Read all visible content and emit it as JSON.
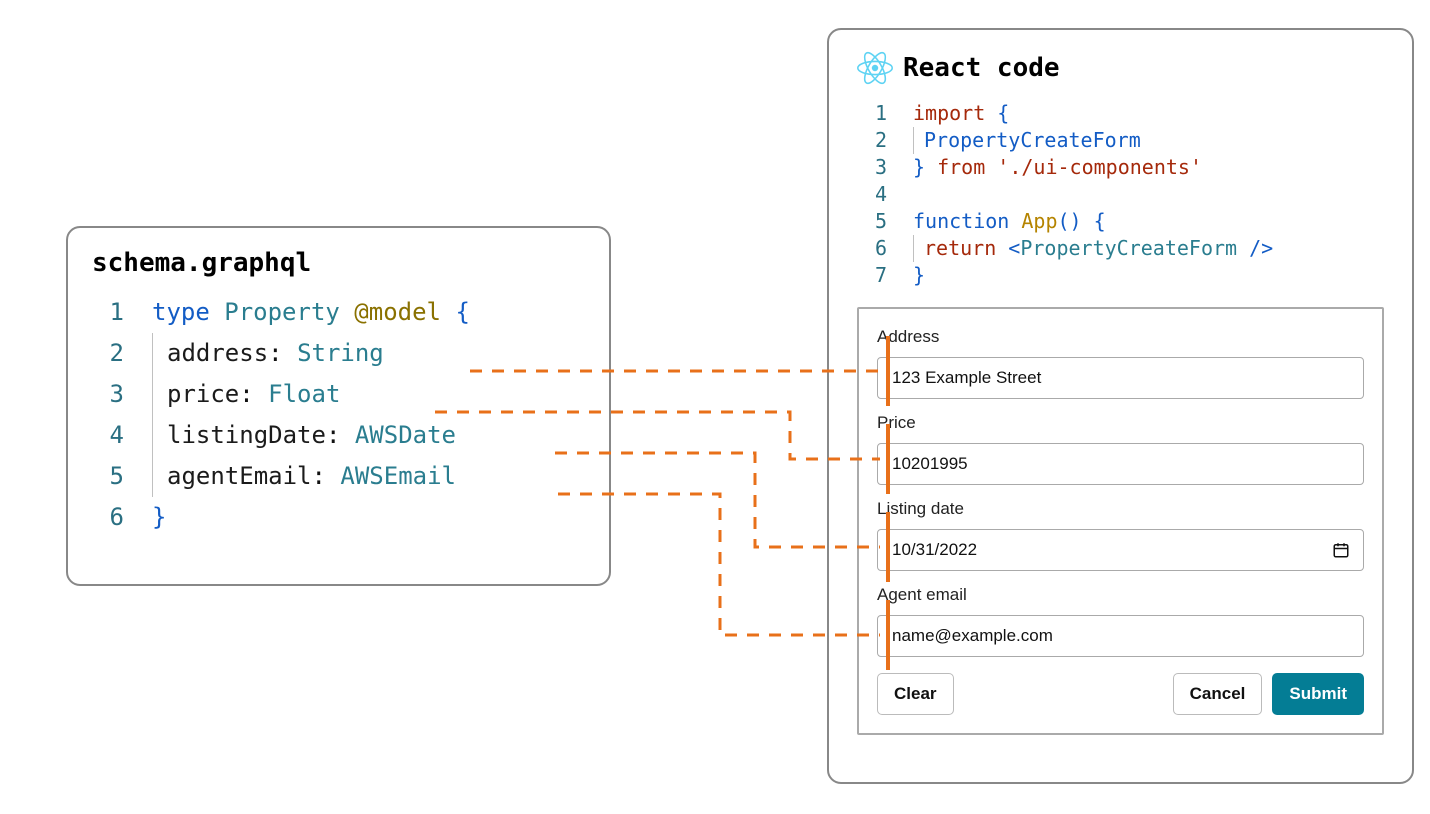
{
  "left": {
    "title": "schema.graphql",
    "lines": [
      {
        "ln": "1",
        "raw": "type Property @model {"
      },
      {
        "ln": "2",
        "field": "address",
        "type": "String"
      },
      {
        "ln": "3",
        "field": "price",
        "type": "Float"
      },
      {
        "ln": "4",
        "field": "listingDate",
        "type": "AWSDate"
      },
      {
        "ln": "5",
        "field": "agentEmail",
        "type": "AWSEmail"
      },
      {
        "ln": "6",
        "raw": "}"
      }
    ]
  },
  "right": {
    "title": "React code",
    "code_lines": {
      "l1": "1",
      "l2": "2",
      "l3": "3",
      "l4": "4",
      "l5": "5",
      "l6": "6",
      "l7": "7",
      "import_kw": "import",
      "open_brace": " {",
      "component": "PropertyCreateForm",
      "close_brace": "} ",
      "from_kw": "from",
      "path": " './ui-components'",
      "function_kw": "function",
      "fn_name": " App",
      "parens_brace": "() {",
      "return_kw": "return",
      "jsx_open": " <",
      "jsx_comp": "PropertyCreateForm",
      "jsx_close": " />",
      "end_brace": "}"
    },
    "form": {
      "fields": {
        "address": {
          "label": "Address",
          "value": "123 Example Street"
        },
        "price": {
          "label": "Price",
          "value": "10201995"
        },
        "listing_date": {
          "label": "Listing date",
          "value": "10/31/2022"
        },
        "agent_email": {
          "label": "Agent email",
          "value": "name@example.com"
        }
      },
      "buttons": {
        "clear": "Clear",
        "cancel": "Cancel",
        "submit": "Submit"
      }
    }
  },
  "colors": {
    "connector": "#e8701a",
    "submit": "#047d95"
  }
}
